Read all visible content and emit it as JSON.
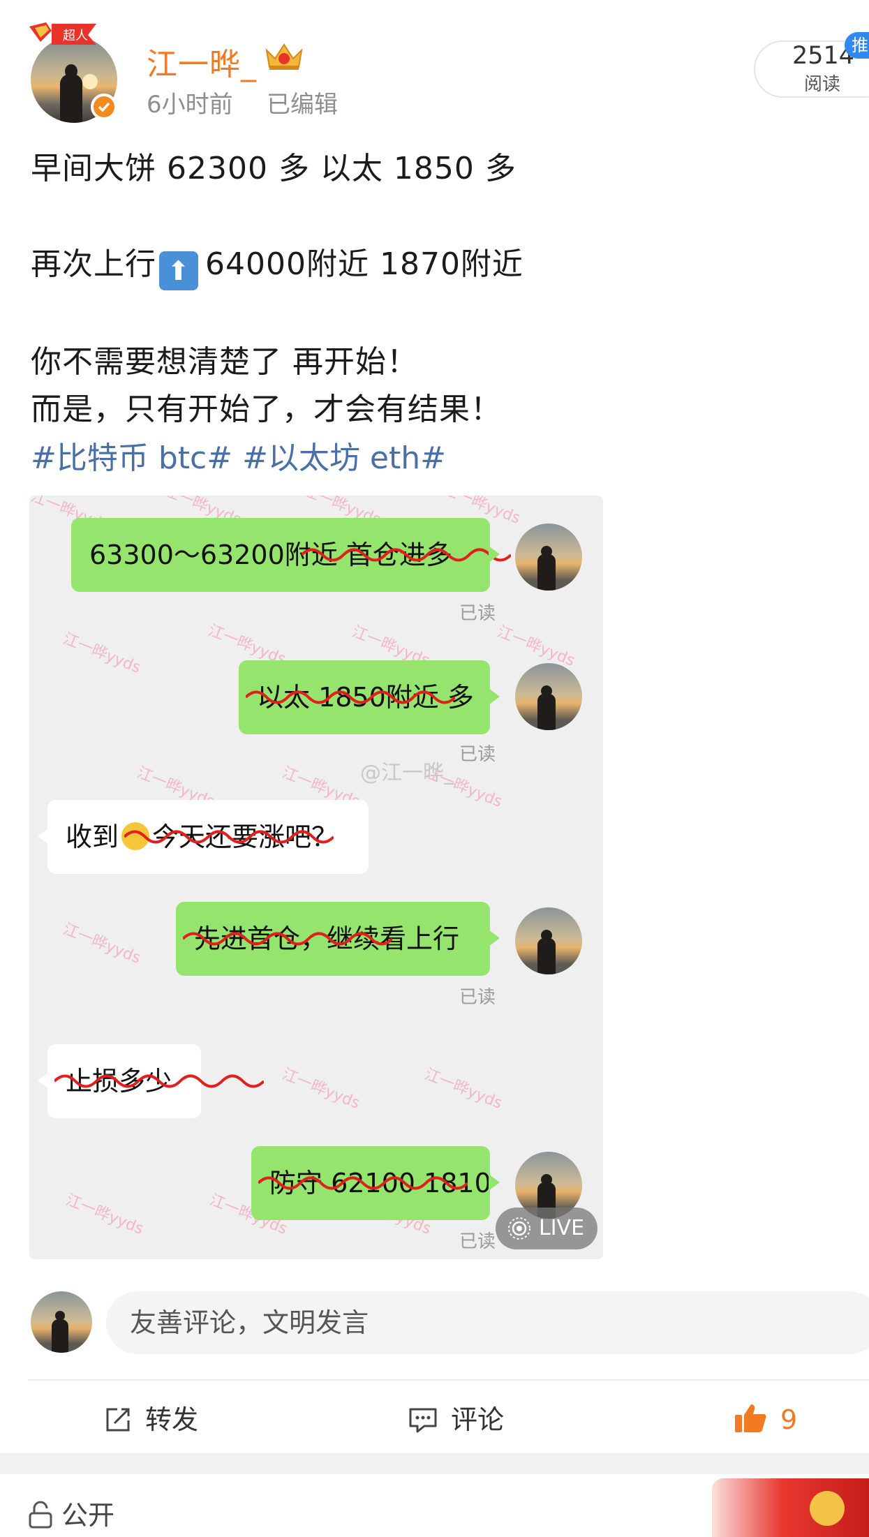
{
  "post": {
    "username": "江一晔_",
    "time": "6小时前",
    "edited": "已编辑",
    "read_count": "2514",
    "read_label": "阅读",
    "push_label": "推",
    "super_badge": "超人",
    "lines": [
      "早间大饼 62300 多 以太 1850 多",
      "再次上行",
      "64000附近   1870附近",
      "你不需要想清楚了 再开始！",
      "而是，只有开始了，才会有结果！"
    ],
    "hashtags": "#比特币 btc# #以太坊 eth#"
  },
  "chat_image": {
    "messages": [
      {
        "side": "right",
        "text": "63300～63200附近 首仓进多",
        "status": "已读"
      },
      {
        "side": "right",
        "text": "以太 1850附近 多",
        "status": "已读"
      },
      {
        "side": "left",
        "text_a": "收到",
        "text_b": "今天还要涨吧？"
      },
      {
        "side": "right",
        "text": "先进首仓，继续看上行",
        "status": "已读"
      },
      {
        "side": "left",
        "text": "止损多少"
      },
      {
        "side": "right",
        "text": "防守 62100 1810",
        "status": "已读"
      }
    ],
    "watermark": "江一晔yyds",
    "weibo_watermark": "@江一晔_",
    "live_label": "LIVE"
  },
  "comment": {
    "placeholder": "友善评论，文明发言"
  },
  "actions": {
    "repost": "转发",
    "comment": "评论",
    "like_count": "9"
  },
  "footer": {
    "visibility": "公开"
  },
  "colors": {
    "username": "#f27a22",
    "hashtag": "#4a6ea8",
    "bubble_green": "#95e46d",
    "strike_red": "#e0201c",
    "like": "#f27a22"
  },
  "icons": [
    "crown-icon",
    "verified-icon",
    "up-arrow-emoji-icon",
    "repost-icon",
    "comment-icon",
    "like-icon",
    "lock-icon",
    "live-icon"
  ]
}
